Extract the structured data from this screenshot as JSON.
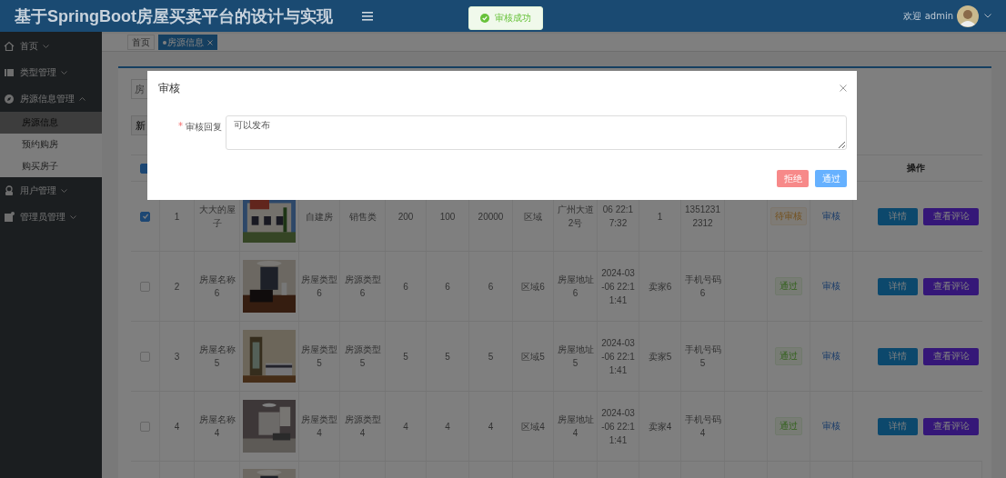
{
  "header": {
    "title": "基于SpringBoot房屋买卖平台的设计与实现",
    "greeting": "欢迎 admin"
  },
  "toast": {
    "text": "审核成功",
    "kind": "success"
  },
  "sidebar": {
    "items": [
      {
        "label": "首页",
        "expanded": false
      },
      {
        "label": "类型管理",
        "expanded": false
      },
      {
        "label": "房源信息管理",
        "expanded": true,
        "children": [
          {
            "label": "房源信息",
            "selected": true
          },
          {
            "label": "预约购房",
            "selected": false
          },
          {
            "label": "购买房子",
            "selected": false
          }
        ]
      },
      {
        "label": "用户管理",
        "expanded": false
      },
      {
        "label": "管理员管理",
        "expanded": false
      }
    ]
  },
  "tabs": [
    {
      "label": "首页",
      "selected": false
    },
    {
      "label": "房源信息",
      "selected": true
    }
  ],
  "toolbar": {
    "search_placeholder": "房",
    "button": "新"
  },
  "table": {
    "header_indeterminate": true,
    "operations_heading": "操作",
    "rows": [
      {
        "checked": true,
        "index": "1",
        "name": "大大的屋子",
        "house_type": "自建房",
        "source_type": "销售类",
        "column_7": "200",
        "column_8": "100",
        "column_9": "20000",
        "region": "区域",
        "address": "广州大道2号",
        "time": "06 22:17:32",
        "seller": "1",
        "phone": "13512312312",
        "status": {
          "text": "待审核",
          "kind": "pending"
        },
        "audit": "审核",
        "actions": [
          "详情",
          "查看评论"
        ]
      },
      {
        "checked": false,
        "index": "2",
        "name": "房屋名称6",
        "house_type": "房屋类型6",
        "source_type": "房源类型6",
        "column_7": "6",
        "column_8": "6",
        "column_9": "6",
        "region": "区域6",
        "address": "房屋地址6",
        "time": "2024-03-06 22:11:41",
        "seller": "卖家6",
        "phone": "手机号码6",
        "status": {
          "text": "通过",
          "kind": "passed"
        },
        "audit": "审核",
        "actions": [
          "详情",
          "查看评论"
        ]
      },
      {
        "checked": false,
        "index": "3",
        "name": "房屋名称5",
        "house_type": "房屋类型5",
        "source_type": "房源类型5",
        "column_7": "5",
        "column_8": "5",
        "column_9": "5",
        "region": "区域5",
        "address": "房屋地址5",
        "time": "2024-03-06 22:11:41",
        "seller": "卖家5",
        "phone": "手机号码5",
        "status": {
          "text": "通过",
          "kind": "passed"
        },
        "audit": "审核",
        "actions": [
          "详情",
          "查看评论"
        ]
      },
      {
        "checked": false,
        "index": "4",
        "name": "房屋名称4",
        "house_type": "房屋类型4",
        "source_type": "房源类型4",
        "column_7": "4",
        "column_8": "4",
        "column_9": "4",
        "region": "区域4",
        "address": "房屋地址4",
        "time": "2024-03-06 22:11:41",
        "seller": "卖家4",
        "phone": "手机号码4",
        "status": {
          "text": "通过",
          "kind": "passed"
        },
        "audit": "审核",
        "actions": [
          "详情",
          "查看评论"
        ]
      }
    ]
  },
  "dialog": {
    "title": "审核",
    "field_label": "审核回复",
    "required_mark": "*",
    "value": "可以发布",
    "buttons": [
      {
        "label": "拒绝",
        "kind": "danger"
      },
      {
        "label": "通过",
        "kind": "primary"
      }
    ]
  }
}
